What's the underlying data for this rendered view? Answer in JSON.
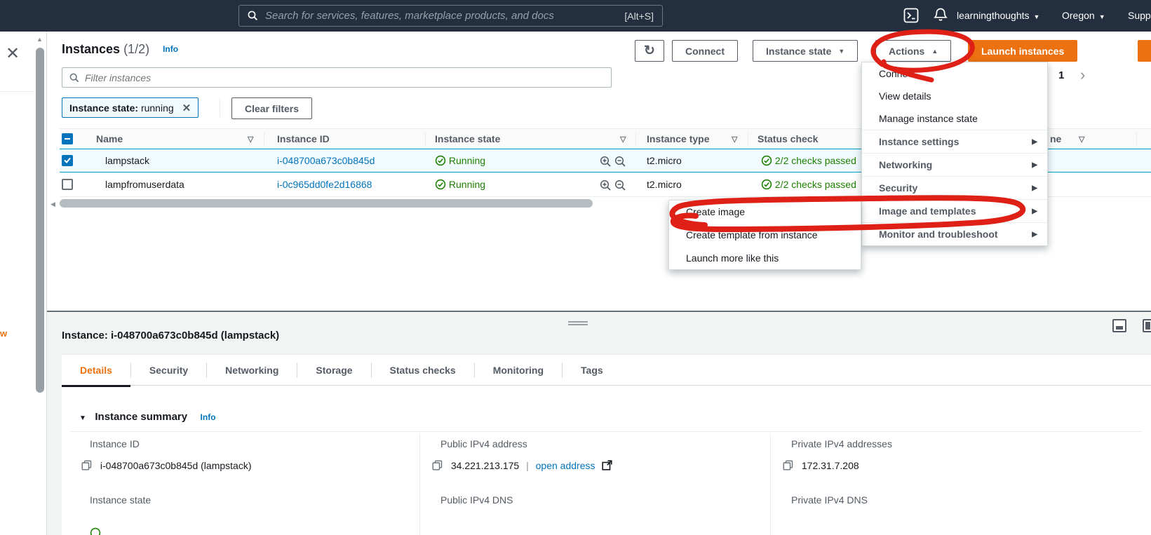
{
  "topnav": {
    "search_placeholder": "Search for services, features, marketplace products, and docs",
    "search_shortcut": "[Alt+S]",
    "account": "learningthoughts",
    "region": "Oregon",
    "support_fragment": "Supp"
  },
  "page": {
    "title": "Instances",
    "count": "(1/2)",
    "info": "Info",
    "page_number": "1"
  },
  "toolbar": {
    "connect": "Connect",
    "instance_state": "Instance state",
    "actions": "Actions",
    "launch": "Launch instances"
  },
  "filter": {
    "placeholder": "Filter instances",
    "tag_label": "Instance state:",
    "tag_value": "running",
    "clear": "Clear filters"
  },
  "table": {
    "col_name": "Name",
    "col_id": "Instance ID",
    "col_state": "Instance state",
    "col_type": "Instance type",
    "col_status": "Status check",
    "col_fragment": "ne",
    "rows": [
      {
        "name": "lampstack",
        "id": "i-048700a673c0b845d",
        "state": "Running",
        "type": "t2.micro",
        "status": "2/2 checks passed"
      },
      {
        "name": "lampfromuserdata",
        "id": "i-0c965dd0fe2d16868",
        "state": "Running",
        "type": "t2.micro",
        "status": "2/2 checks passed"
      }
    ]
  },
  "actions_menu": {
    "connect": "Connect",
    "view_details": "View details",
    "manage_state": "Manage instance state",
    "instance_settings": "Instance settings",
    "networking": "Networking",
    "security": "Security",
    "image_templates": "Image and templates",
    "monitor": "Monitor and troubleshoot"
  },
  "submenu": {
    "create_image": "Create image",
    "create_template": "Create template from instance",
    "launch_more": "Launch more like this"
  },
  "detail": {
    "title": "Instance: i-048700a673c0b845d (lampstack)",
    "tabs": [
      "Details",
      "Security",
      "Networking",
      "Storage",
      "Status checks",
      "Monitoring",
      "Tags"
    ],
    "summary": "Instance summary",
    "info": "Info",
    "instance_id_label": "Instance ID",
    "instance_id_value": "i-048700a673c0b845d (lampstack)",
    "public_ip_label": "Public IPv4 address",
    "public_ip_value": "34.221.213.175",
    "separator": "|",
    "open_address": "open address",
    "private_ip_label": "Private IPv4 addresses",
    "private_ip_value": "172.31.7.208",
    "state_label": "Instance state",
    "public_dns_label": "Public IPv4 DNS",
    "private_dns_label": "Private IPv4 DNS"
  },
  "fragments": {
    "sidebar_w": "w"
  },
  "colors": {
    "nav_bg": "#232f3e",
    "accent": "#ec7211",
    "link": "#0073bb",
    "running": "#1d8102",
    "selected_border": "#00a1c9",
    "annotation": "#de2016"
  }
}
